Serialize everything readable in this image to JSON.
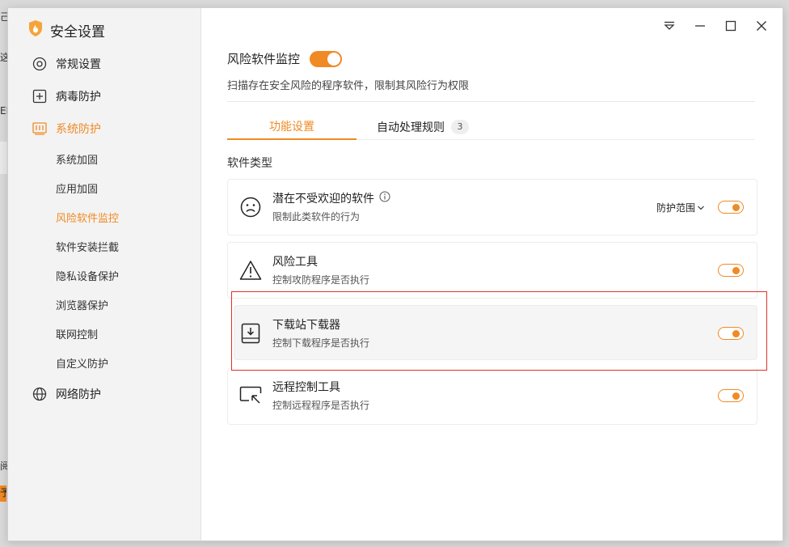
{
  "window": {
    "title": "安全设置"
  },
  "background_fragments": [
    "己",
    "这",
    "EI",
    "阅",
    "予"
  ],
  "sidebar": {
    "items": [
      {
        "label": "常规设置",
        "icon": "gear-icon"
      },
      {
        "label": "病毒防护",
        "icon": "plus-square-icon"
      },
      {
        "label": "系统防护",
        "icon": "system-protect-icon",
        "active": true
      },
      {
        "label": "网络防护",
        "icon": "globe-icon"
      }
    ],
    "sub_items": [
      {
        "label": "系统加固"
      },
      {
        "label": "应用加固"
      },
      {
        "label": "风险软件监控",
        "active": true
      },
      {
        "label": "软件安装拦截"
      },
      {
        "label": "隐私设备保护"
      },
      {
        "label": "浏览器保护"
      },
      {
        "label": "联网控制"
      },
      {
        "label": "自定义防护"
      }
    ]
  },
  "header": {
    "title": "风险软件监控",
    "description": "扫描存在安全风险的程序软件，限制其风险行为权限",
    "enabled": true
  },
  "tabs": [
    {
      "label": "功能设置",
      "active": true
    },
    {
      "label": "自动处理规则",
      "badge": "3"
    }
  ],
  "section": {
    "label": "软件类型"
  },
  "cards": [
    {
      "title": "潜在不受欢迎的软件",
      "description": "限制此类软件的行为",
      "icon": "sad-face-icon",
      "scope_label": "防护范围",
      "enabled": true
    },
    {
      "title": "风险工具",
      "description": "控制攻防程序是否执行",
      "icon": "warning-icon",
      "enabled": true
    },
    {
      "title": "下载站下载器",
      "description": "控制下载程序是否执行",
      "icon": "download-box-icon",
      "enabled": true,
      "highlighted": true
    },
    {
      "title": "远程控制工具",
      "description": "控制远程程序是否执行",
      "icon": "remote-screen-icon",
      "enabled": true
    }
  ],
  "colors": {
    "accent": "#f08a24",
    "highlight_border": "#e0302a"
  }
}
